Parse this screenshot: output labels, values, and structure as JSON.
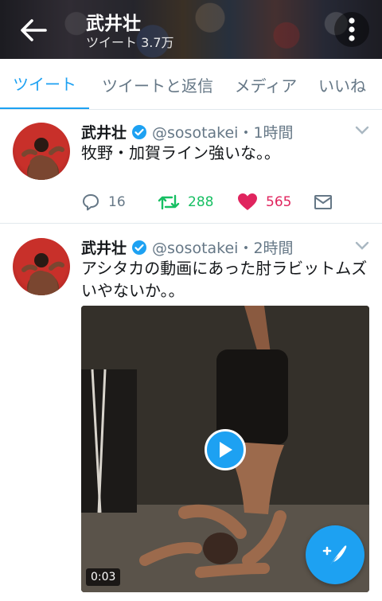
{
  "header": {
    "title": "武井壮",
    "subtitle": "ツイート 3.7万"
  },
  "tabs": [
    {
      "label": "ツイート",
      "active": true
    },
    {
      "label": "ツイートと返信",
      "active": false
    },
    {
      "label": "メディア",
      "active": false
    },
    {
      "label": "いいね",
      "active": false
    }
  ],
  "tweets": [
    {
      "name": "武井壮",
      "verified": true,
      "handle_time": "@sosotakei・1時間",
      "text": "牧野・加賀ライン強いな。。",
      "replies": "16",
      "retweets": "288",
      "likes": "565"
    },
    {
      "name": "武井壮",
      "verified": true,
      "handle_time": "@sosotakei・2時間",
      "text": "アシタカの動画にあった肘ラビットムズいやないか。。",
      "video_duration": "0:03"
    }
  ],
  "colors": {
    "accent": "#1da1f2",
    "retweet": "#17bf63",
    "like": "#e0245e",
    "muted": "#657786"
  },
  "icons": [
    "back-arrow-icon",
    "more-vertical-icon",
    "verified-badge-icon",
    "chevron-down-icon",
    "reply-icon",
    "retweet-icon",
    "heart-icon",
    "envelope-icon",
    "play-icon",
    "compose-tweet-icon"
  ]
}
